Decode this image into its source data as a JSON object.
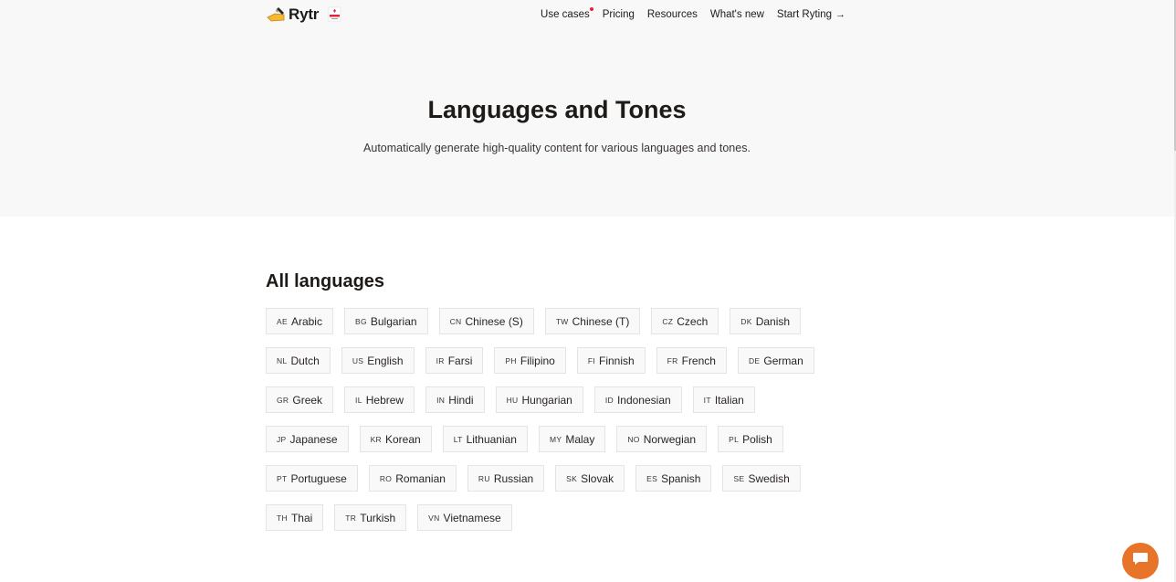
{
  "nav": {
    "logo_text": "Rytr",
    "links": [
      {
        "label": "Use cases"
      },
      {
        "label": "Pricing"
      },
      {
        "label": "Resources"
      },
      {
        "label": "What's new"
      },
      {
        "label": "Start Ryting"
      }
    ]
  },
  "hero": {
    "title": "Languages and Tones",
    "subtitle": "Automatically generate high-quality content for various languages and tones."
  },
  "languages": {
    "title": "All languages",
    "rows": [
      [
        {
          "code": "AE",
          "name": "Arabic"
        },
        {
          "code": "BG",
          "name": "Bulgarian"
        },
        {
          "code": "CN",
          "name": "Chinese (S)"
        },
        {
          "code": "TW",
          "name": "Chinese (T)"
        },
        {
          "code": "CZ",
          "name": "Czech"
        },
        {
          "code": "DK",
          "name": "Danish"
        }
      ],
      [
        {
          "code": "NL",
          "name": "Dutch"
        },
        {
          "code": "US",
          "name": "English"
        },
        {
          "code": "IR",
          "name": "Farsi"
        },
        {
          "code": "PH",
          "name": "Filipino"
        },
        {
          "code": "FI",
          "name": "Finnish"
        },
        {
          "code": "FR",
          "name": "French"
        },
        {
          "code": "DE",
          "name": "German"
        }
      ],
      [
        {
          "code": "GR",
          "name": "Greek"
        },
        {
          "code": "IL",
          "name": "Hebrew"
        },
        {
          "code": "IN",
          "name": "Hindi"
        },
        {
          "code": "HU",
          "name": "Hungarian"
        },
        {
          "code": "ID",
          "name": "Indonesian"
        },
        {
          "code": "IT",
          "name": "Italian"
        }
      ],
      [
        {
          "code": "JP",
          "name": "Japanese"
        },
        {
          "code": "KR",
          "name": "Korean"
        },
        {
          "code": "LT",
          "name": "Lithuanian"
        },
        {
          "code": "MY",
          "name": "Malay"
        },
        {
          "code": "NO",
          "name": "Norwegian"
        },
        {
          "code": "PL",
          "name": "Polish"
        }
      ],
      [
        {
          "code": "PT",
          "name": "Portuguese"
        },
        {
          "code": "RO",
          "name": "Romanian"
        },
        {
          "code": "RU",
          "name": "Russian"
        },
        {
          "code": "SK",
          "name": "Slovak"
        },
        {
          "code": "ES",
          "name": "Spanish"
        },
        {
          "code": "SE",
          "name": "Swedish"
        }
      ],
      [
        {
          "code": "TH",
          "name": "Thai"
        },
        {
          "code": "TR",
          "name": "Turkish"
        },
        {
          "code": "VN",
          "name": "Vietnamese"
        }
      ]
    ]
  },
  "colors": {
    "accent": "#e8742a",
    "notification_dot": "#e5243b",
    "hero_background": "#f8f8f8"
  },
  "icons": {
    "logo": "writing-hand-icon",
    "badge": "award-badge-icon",
    "arrow": "arrow-right-icon",
    "chat": "chat-bubble-icon"
  }
}
